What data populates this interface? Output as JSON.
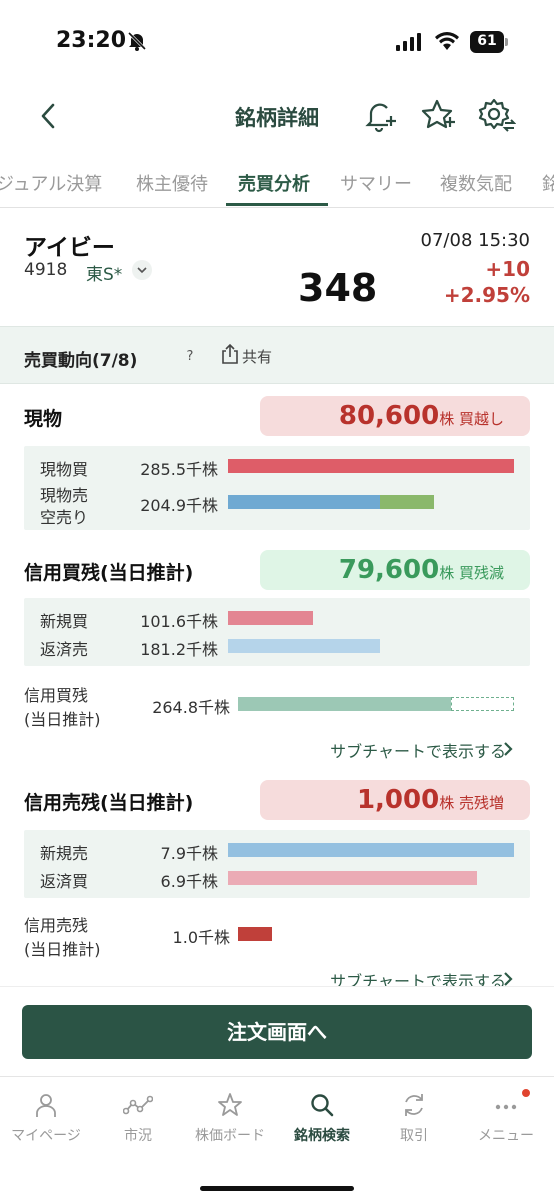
{
  "status_bar": {
    "time": "23:20",
    "battery": "61"
  },
  "header": {
    "title": "銘柄詳細"
  },
  "tabs": [
    "ジュアル決算",
    "株主優待",
    "売買分析",
    "サマリー",
    "複数気配",
    "銘"
  ],
  "stock": {
    "name": "アイビー",
    "code": "4918",
    "market": "東S*",
    "price": "348",
    "datetime": "07/08 15:30",
    "change": "+10",
    "change_pct": "+2.95%"
  },
  "trend": {
    "title": "売買動向(7/8)",
    "help": "?",
    "share_label": "共有"
  },
  "spot": {
    "title": "現物",
    "badge_value": "80,600",
    "badge_unit": "株 買越し",
    "rows": [
      {
        "label": "現物買",
        "value": "285.5千株",
        "color": "#de5d68",
        "ratio": 1.0
      },
      {
        "label": "現物売",
        "label2": "空売り",
        "value": "204.9千株",
        "color": "#6fa9d2",
        "ratio": 0.72,
        "sub_color": "#8ab86b",
        "sub_ratio": 0.19
      }
    ]
  },
  "margin_buy": {
    "title": "信用買残(当日推計)",
    "badge_value": "79,600",
    "badge_unit": "株 買残減",
    "rows": [
      {
        "label": "新規買",
        "value": "101.6千株",
        "color": "#e38592",
        "ratio": 0.297
      },
      {
        "label": "返済売",
        "value": "181.2千株",
        "color": "#b5d4ea",
        "ratio": 0.53
      }
    ],
    "total_label1": "信用買残",
    "total_label2": "(当日推計)",
    "total_value": "264.8千株",
    "total_color": "#9cc8b5",
    "total_ratio": 0.77,
    "sub_link": "サブチャートで表示する"
  },
  "margin_sell": {
    "title": "信用売残(当日推計)",
    "badge_value": "1,000",
    "badge_unit": "株 売残増",
    "rows": [
      {
        "label": "新規売",
        "value": "7.9千株",
        "color": "#94c0e0",
        "ratio": 1.0
      },
      {
        "label": "返済買",
        "value": "6.9千株",
        "color": "#ebabb5",
        "ratio": 0.87
      }
    ],
    "total_label1": "信用売残",
    "total_label2": "(当日推計)",
    "total_value": "1.0千株",
    "total_color": "#c0403a",
    "sub_link": "サブチャートで表示する"
  },
  "order_button": "注文画面へ",
  "nav": [
    {
      "label": "マイページ",
      "icon": "person-icon"
    },
    {
      "label": "市況",
      "icon": "line-chart-icon"
    },
    {
      "label": "株価ボード",
      "icon": "star-icon"
    },
    {
      "label": "銘柄検索",
      "icon": "search-icon"
    },
    {
      "label": "取引",
      "icon": "refresh-icon"
    },
    {
      "label": "メニュー",
      "icon": "more-icon"
    }
  ]
}
